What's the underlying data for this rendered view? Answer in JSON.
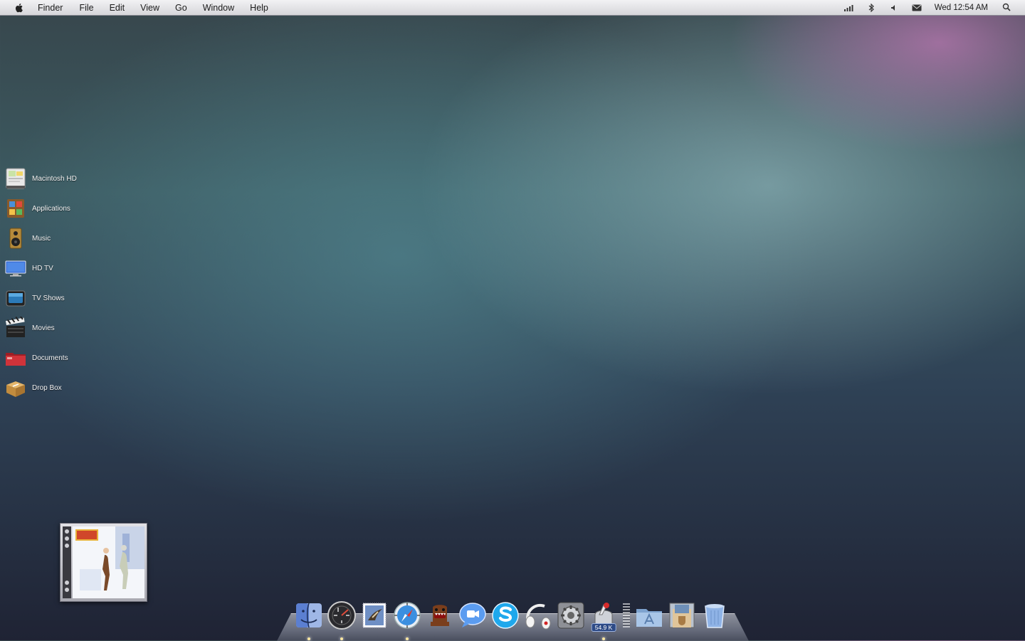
{
  "menubar": {
    "app_name": "Finder",
    "menus": [
      "File",
      "Edit",
      "View",
      "Go",
      "Window",
      "Help"
    ],
    "status_icons": [
      "signal-bars-icon",
      "bluetooth-icon",
      "volume-icon",
      "mail-icon"
    ],
    "clock": "Wed 12:54 AM"
  },
  "desktop": {
    "items": [
      {
        "label": "Macintosh HD",
        "icon": "hard-drive-icon"
      },
      {
        "label": "Applications",
        "icon": "applications-folder-icon"
      },
      {
        "label": "Music",
        "icon": "speaker-icon"
      },
      {
        "label": "HD TV",
        "icon": "monitor-icon"
      },
      {
        "label": "TV Shows",
        "icon": "tv-icon"
      },
      {
        "label": "Movies",
        "icon": "clapperboard-icon"
      },
      {
        "label": "Documents",
        "icon": "red-folder-icon"
      },
      {
        "label": "Drop Box",
        "icon": "box-icon"
      }
    ]
  },
  "album_widget": {
    "icon": "album-cover-icon"
  },
  "dock": {
    "apps": [
      "finder-icon",
      "itunes-icon",
      "mail-icon",
      "safari-icon",
      "domo-icon",
      "ichat-icon",
      "skype-icon",
      "headphones-icon",
      "system-preferences-icon",
      "transmission-icon"
    ],
    "transmission_badge": "54.9 K",
    "stacks": [
      "applications-stack-icon",
      "downloads-stack-icon",
      "trash-icon"
    ]
  },
  "colors": {
    "menubar": "#dcdce0",
    "label_text": "#f2f2f2",
    "badge": "#2d4a86"
  }
}
